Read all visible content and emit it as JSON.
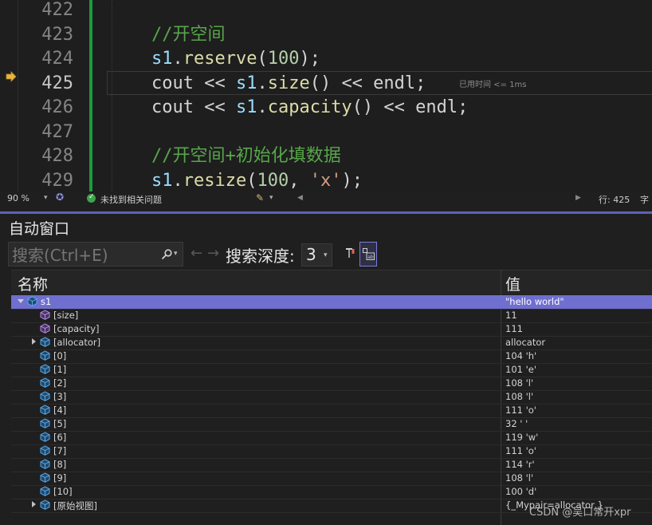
{
  "editor": {
    "lines": [
      {
        "num": "422",
        "tokens": []
      },
      {
        "num": "423",
        "tokens": [
          {
            "cls": "cmt",
            "text": "//开空间"
          }
        ]
      },
      {
        "num": "424",
        "tokens": [
          {
            "cls": "var",
            "text": "s1"
          },
          {
            "cls": "op",
            "text": "."
          },
          {
            "cls": "fn",
            "text": "reserve"
          },
          {
            "cls": "op",
            "text": "("
          },
          {
            "cls": "num",
            "text": "100"
          },
          {
            "cls": "op",
            "text": ");"
          }
        ]
      },
      {
        "num": "425",
        "tokens": [
          {
            "cls": "op",
            "text": "cout << "
          },
          {
            "cls": "var",
            "text": "s1"
          },
          {
            "cls": "op",
            "text": "."
          },
          {
            "cls": "fn",
            "text": "size"
          },
          {
            "cls": "op",
            "text": "() << endl;"
          }
        ]
      },
      {
        "num": "426",
        "tokens": [
          {
            "cls": "op",
            "text": "cout << "
          },
          {
            "cls": "var",
            "text": "s1"
          },
          {
            "cls": "op",
            "text": "."
          },
          {
            "cls": "fn",
            "text": "capacity"
          },
          {
            "cls": "op",
            "text": "() << endl;"
          }
        ]
      },
      {
        "num": "427",
        "tokens": []
      },
      {
        "num": "428",
        "tokens": [
          {
            "cls": "cmt",
            "text": "//开空间+初始化填数据"
          }
        ]
      },
      {
        "num": "429",
        "tokens": [
          {
            "cls": "var",
            "text": "s1"
          },
          {
            "cls": "op",
            "text": "."
          },
          {
            "cls": "fn",
            "text": "resize"
          },
          {
            "cls": "op",
            "text": "("
          },
          {
            "cls": "num",
            "text": "100"
          },
          {
            "cls": "op",
            "text": ", "
          },
          {
            "cls": "str",
            "text": "'x'"
          },
          {
            "cls": "op",
            "text": ");"
          }
        ]
      }
    ],
    "current_line": "425",
    "perf_tip": "已用时间 <= 1ms"
  },
  "statusbar": {
    "zoom": "90 %",
    "issues": "未找到相关问题",
    "line_info": "行: 425",
    "col_info": "字"
  },
  "autos": {
    "title": "自动窗口",
    "search_placeholder": "搜索(Ctrl+E)",
    "depth_label": "搜索深度:",
    "depth_value": "3",
    "col_name": "名称",
    "col_value": "值",
    "rows": [
      {
        "name": "s1",
        "value": "\"hello world\"",
        "indent": 0,
        "twisty": "open",
        "selected": true
      },
      {
        "name": "[size]",
        "value": "11",
        "indent": 1,
        "twisty": "none",
        "selected": false
      },
      {
        "name": "[capacity]",
        "value": "111",
        "indent": 1,
        "twisty": "none",
        "selected": false
      },
      {
        "name": "[allocator]",
        "value": "allocator",
        "indent": 1,
        "twisty": "closed",
        "selected": false
      },
      {
        "name": "[0]",
        "value": "104 'h'",
        "indent": 1,
        "twisty": "none",
        "selected": false
      },
      {
        "name": "[1]",
        "value": "101 'e'",
        "indent": 1,
        "twisty": "none",
        "selected": false
      },
      {
        "name": "[2]",
        "value": "108 'l'",
        "indent": 1,
        "twisty": "none",
        "selected": false
      },
      {
        "name": "[3]",
        "value": "108 'l'",
        "indent": 1,
        "twisty": "none",
        "selected": false
      },
      {
        "name": "[4]",
        "value": "111 'o'",
        "indent": 1,
        "twisty": "none",
        "selected": false
      },
      {
        "name": "[5]",
        "value": "32 ' '",
        "indent": 1,
        "twisty": "none",
        "selected": false
      },
      {
        "name": "[6]",
        "value": "119 'w'",
        "indent": 1,
        "twisty": "none",
        "selected": false
      },
      {
        "name": "[7]",
        "value": "111 'o'",
        "indent": 1,
        "twisty": "none",
        "selected": false
      },
      {
        "name": "[8]",
        "value": "114 'r'",
        "indent": 1,
        "twisty": "none",
        "selected": false
      },
      {
        "name": "[9]",
        "value": "108 'l'",
        "indent": 1,
        "twisty": "none",
        "selected": false
      },
      {
        "name": "[10]",
        "value": "100 'd'",
        "indent": 1,
        "twisty": "none",
        "selected": false
      },
      {
        "name": "[原始视图]",
        "value": "{_Mypair=allocator }",
        "indent": 1,
        "twisty": "closed",
        "selected": false
      }
    ]
  },
  "watermark": "CSDN @吴口常开xpr",
  "colors": {
    "accent": "#6b6bd6",
    "change_bar": "#1c9b3c",
    "comment": "#57a64a",
    "function": "#dcdcaa",
    "variable": "#9cdcfe",
    "number": "#b5cea8",
    "string": "#d69d85"
  },
  "icons": {
    "exec_pointer": "arrow-right-icon",
    "variable": "cube-icon",
    "search": "search-icon",
    "status_ok": "check-circle-icon"
  }
}
